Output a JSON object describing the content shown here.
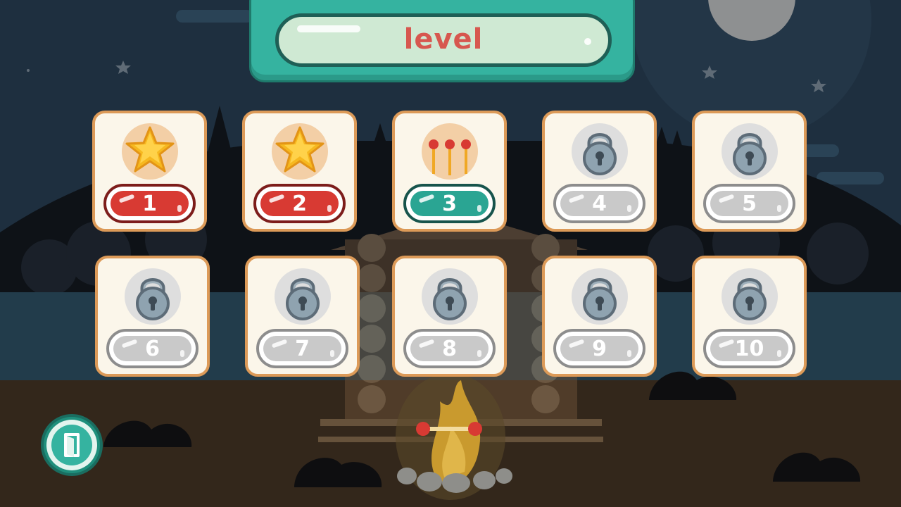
{
  "header": {
    "title": "level"
  },
  "levels": [
    {
      "number": "1",
      "state": "completed",
      "icon": "star-icon"
    },
    {
      "number": "2",
      "state": "completed",
      "icon": "star-icon"
    },
    {
      "number": "3",
      "state": "current",
      "icon": "matches-icon"
    },
    {
      "number": "4",
      "state": "locked",
      "icon": "lock-icon"
    },
    {
      "number": "5",
      "state": "locked",
      "icon": "lock-icon"
    },
    {
      "number": "6",
      "state": "locked",
      "icon": "lock-icon"
    },
    {
      "number": "7",
      "state": "locked",
      "icon": "lock-icon"
    },
    {
      "number": "8",
      "state": "locked",
      "icon": "lock-icon"
    },
    {
      "number": "9",
      "state": "locked",
      "icon": "lock-icon"
    },
    {
      "number": "10",
      "state": "locked",
      "icon": "lock-icon"
    }
  ],
  "exit_button": {
    "icon": "door-icon"
  },
  "colors": {
    "completed": "#d83a33",
    "current": "#2aa593",
    "locked": "#c9c9c9",
    "card_border": "#dc9a58",
    "title": "#d7574f"
  }
}
